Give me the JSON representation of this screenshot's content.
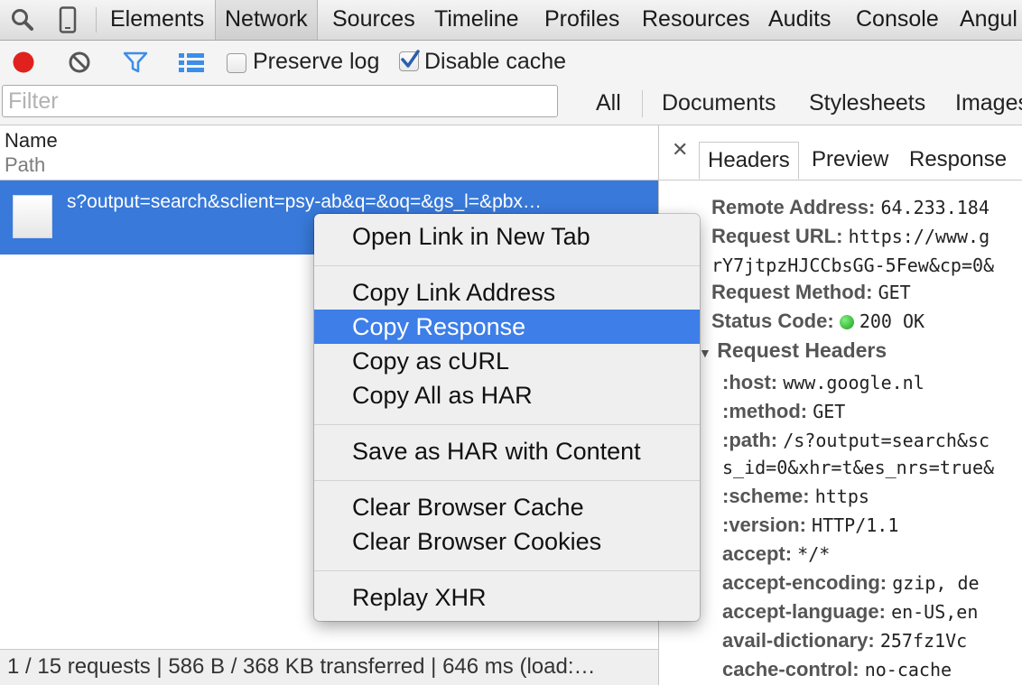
{
  "main_tabs": [
    "Elements",
    "Network",
    "Sources",
    "Timeline",
    "Profiles",
    "Resources",
    "Audits",
    "Console",
    "Angul"
  ],
  "active_tab": "Network",
  "toolbar": {
    "preserve_log_label": "Preserve log",
    "preserve_log_checked": false,
    "disable_cache_label": "Disable cache",
    "disable_cache_checked": true
  },
  "filter": {
    "placeholder": "Filter",
    "types": [
      "All",
      "Documents",
      "Stylesheets",
      "Images"
    ]
  },
  "columns": {
    "name": "Name",
    "path": "Path"
  },
  "request_row": {
    "url": "s?output=search&sclient=psy-ab&q=&oq=&gs_l=&pbx…"
  },
  "status_bar": "1 / 15 requests | 586 B / 368 KB transferred | 646 ms (load:…",
  "detail_tabs": [
    "Headers",
    "Preview",
    "Response"
  ],
  "headers": {
    "general": [
      {
        "key": "Remote Address:",
        "value": "64.233.184"
      },
      {
        "key": "Request URL:",
        "value": "https://www.g"
      },
      {
        "key": "",
        "value": "rY7jtpzHJCCbsGG-5Few&cp=0&"
      },
      {
        "key": "Request Method:",
        "value": "GET"
      },
      {
        "key": "Status Code:",
        "value": "200 OK"
      }
    ],
    "request_headers_title": "Request Headers",
    "request_headers": [
      {
        "key": ":host:",
        "value": "www.google.nl"
      },
      {
        "key": ":method:",
        "value": "GET"
      },
      {
        "key": ":path:",
        "value": "/s?output=search&sc"
      },
      {
        "key": "",
        "value": "s_id=0&xhr=t&es_nrs=true&"
      },
      {
        "key": ":scheme:",
        "value": "https"
      },
      {
        "key": ":version:",
        "value": "HTTP/1.1"
      },
      {
        "key": "accept:",
        "value": "*/*"
      },
      {
        "key": "accept-encoding:",
        "value": "gzip, de"
      },
      {
        "key": "accept-language:",
        "value": "en-US,en"
      },
      {
        "key": "avail-dictionary:",
        "value": "257fz1Vc"
      },
      {
        "key": "cache-control:",
        "value": "no-cache"
      }
    ]
  },
  "context_menu": {
    "items": [
      "Open Link in New Tab",
      "Copy Link Address",
      "Copy Response",
      "Copy as cURL",
      "Copy All as HAR",
      "Save as HAR with Content",
      "Clear Browser Cache",
      "Clear Browser Cookies",
      "Replay XHR"
    ],
    "highlighted": "Copy Response"
  },
  "colors": {
    "selection_blue": "#3879d9",
    "menu_highlight": "#3d7ee8",
    "record_red": "#e0211e",
    "filter_blue": "#3c8ee8",
    "status_green": "#2bb52b"
  },
  "icons": [
    "search-icon",
    "device-mode-icon",
    "record-icon",
    "clear-icon",
    "filter-icon",
    "list-view-icon",
    "close-icon",
    "file-icon",
    "disclosure-triangle-icon"
  ]
}
